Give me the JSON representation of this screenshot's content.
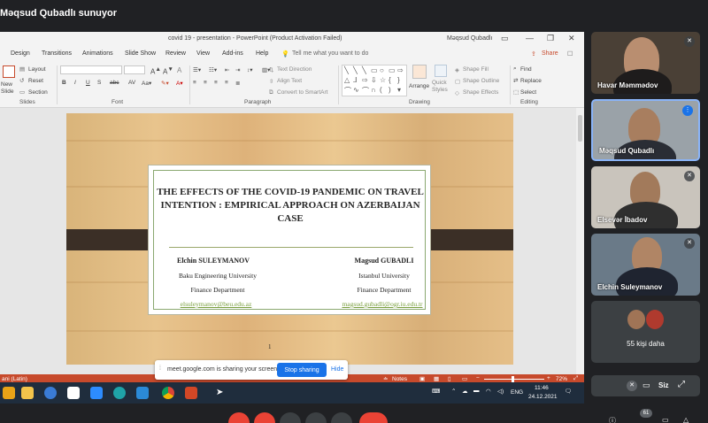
{
  "meet": {
    "presenter_title": "Məqsud Qubadlı sunuyor",
    "sharing_banner": {
      "text": "meet.google.com is sharing your screen.",
      "stop_label": "Stop sharing",
      "hide_label": "Hide"
    },
    "participants": [
      {
        "name": "Havar Məmmədov",
        "muted": true
      },
      {
        "name": "Məqsud Qubadlı",
        "muted": false,
        "speaking": true
      },
      {
        "name": "Elsevər İbadov",
        "muted": true
      },
      {
        "name": "Elchin Suleymanov",
        "muted": true
      }
    ],
    "more": {
      "label": "55 kişi daha"
    },
    "self": {
      "label": "Siz"
    },
    "badge_count": "61"
  },
  "powerpoint": {
    "window_title": "covid 19 - presentation  -  PowerPoint (Product Activation Failed)",
    "user": "Məqsud Qubadlı",
    "menu": [
      "Design",
      "Transitions",
      "Animations",
      "Slide Show",
      "Review",
      "View",
      "Add-ins",
      "Help"
    ],
    "tell_me": "Tell me what you want to do",
    "share_label": "Share",
    "ribbon": {
      "new_slide": "New Slide",
      "layout": "Layout",
      "reset": "Reset",
      "section": "Section",
      "groups": [
        "Slides",
        "Font",
        "Paragraph",
        "Drawing",
        "Editing"
      ],
      "text_direction": "Text Direction",
      "align_text": "Align Text",
      "convert_smartart": "Convert to SmartArt",
      "arrange": "Arrange",
      "quick_styles": "Quick Styles",
      "shape_fill": "Shape Fill",
      "shape_outline": "Shape Outline",
      "shape_effects": "Shape Effects",
      "find": "Find",
      "replace": "Replace",
      "select": "Select"
    },
    "slide": {
      "title": "THE EFFECTS OF THE COVID-19 PANDEMIC ON TRAVEL INTENTION : EMPIRICAL APPROACH ON AZERBAIJAN CASE",
      "author1": {
        "name": "Elchin SULEYMANOV",
        "uni": "Baku Engineering University",
        "dept": "Finance Department",
        "email": "elsuleymanov@beu.edu.az"
      },
      "author2": {
        "name": "Magsud GUBADLI",
        "uni": "Istanbul University",
        "dept": "Finance Department",
        "email": "magsud.gubadli@ogr.iu.edu.tr"
      },
      "page": "1"
    },
    "status": {
      "lang": "ani (Latin)",
      "notes": "Notes",
      "zoom": "72%"
    }
  },
  "taskbar": {
    "time": "11:46",
    "date": "24.12.2021",
    "lang": "ENG"
  },
  "colors": {
    "meet_bg": "#202124",
    "status_red": "#c74a2c",
    "accent_blue": "#1a73e8",
    "end_call": "#ea4335"
  }
}
